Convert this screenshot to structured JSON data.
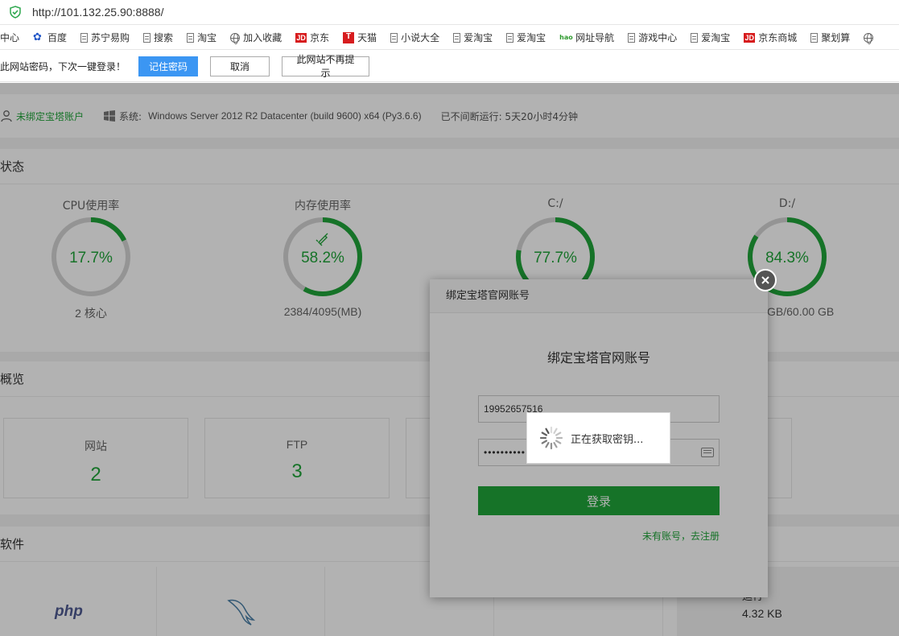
{
  "browser": {
    "url": "http://101.132.25.90:8888/",
    "bookmarks": [
      {
        "label": "中心",
        "icon": "none"
      },
      {
        "label": "百度",
        "icon": "paw-icon"
      },
      {
        "label": "苏宁易购",
        "icon": "doc-icon"
      },
      {
        "label": "搜索",
        "icon": "doc-icon"
      },
      {
        "label": "淘宝",
        "icon": "doc-icon"
      },
      {
        "label": "加入收藏",
        "icon": "globe-icon"
      },
      {
        "label": "京东",
        "icon": "jd-icon"
      },
      {
        "label": "天猫",
        "icon": "tmall-icon"
      },
      {
        "label": "小说大全",
        "icon": "doc-icon"
      },
      {
        "label": "爱淘宝",
        "icon": "doc-icon"
      },
      {
        "label": "爱淘宝",
        "icon": "doc-icon"
      },
      {
        "label": "网址导航",
        "icon": "hao-icon"
      },
      {
        "label": "游戏中心",
        "icon": "doc-icon"
      },
      {
        "label": "爱淘宝",
        "icon": "doc-icon"
      },
      {
        "label": "京东商城",
        "icon": "jd-icon"
      },
      {
        "label": "聚划算",
        "icon": "doc-icon"
      },
      {
        "label": "",
        "icon": "globe-icon"
      }
    ],
    "jd_text": "JD",
    "tmall_text": "T",
    "hao_text": "hao",
    "password_bar": {
      "text": "此网站密码，下次一键登录！",
      "remember": "记住密码",
      "cancel": "取消",
      "never": "此网站不再提示"
    }
  },
  "info": {
    "user": "未绑定宝塔账户",
    "sys_label": "系统:",
    "sys_value": "Windows Server 2012 R2 Datacenter (build 9600) x64 (Py3.6.6)",
    "uptime": "已不间断运行: 5天20小时4分钟"
  },
  "status": {
    "title": "状态",
    "gauges": [
      {
        "label": "CPU使用率",
        "value": "17.7%",
        "percent": 17.7,
        "sub": "2 核心"
      },
      {
        "label": "内存使用率",
        "value": "58.2%",
        "percent": 58.2,
        "sub": "2384/4095(MB)"
      },
      {
        "label": "C:/",
        "value": "77.7%",
        "percent": 77.7,
        "sub": ""
      },
      {
        "label": "D:/",
        "value": "84.3%",
        "percent": 84.3,
        "sub": "GB/60.00 GB"
      }
    ]
  },
  "overview": {
    "title": "概览",
    "cards": [
      {
        "name": "网站",
        "value": "2"
      },
      {
        "name": "FTP",
        "value": "3"
      }
    ]
  },
  "software": {
    "title": "软件",
    "php": "php",
    "run_label": "运行",
    "size": "4.32 KB"
  },
  "dialog": {
    "header": "绑定宝塔官网账号",
    "title": "绑定宝塔官网账号",
    "username": "19952657516",
    "password": "••••••••••",
    "login": "登录",
    "register": "未有账号，去注册"
  },
  "toast": {
    "text": "正在获取密钥..."
  },
  "colors": {
    "accent": "#20a53a",
    "blue": "#3b96f3"
  }
}
